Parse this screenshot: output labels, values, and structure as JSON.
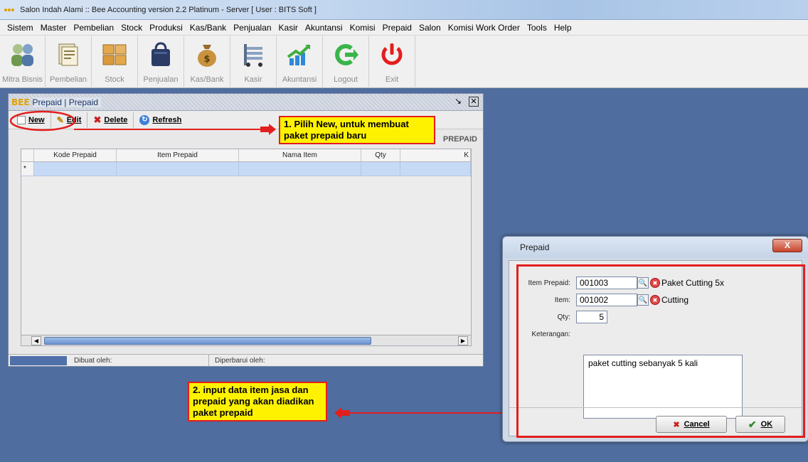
{
  "window": {
    "title": "Salon Indah Alami :: Bee Accounting version 2.2 Platinum - Server  [ User : BITS Soft ]"
  },
  "menu": [
    "Sistem",
    "Master",
    "Pembelian",
    "Stock",
    "Produksi",
    "Kas/Bank",
    "Penjualan",
    "Kasir",
    "Akuntansi",
    "Komisi",
    "Prepaid",
    "Salon",
    "Komisi Work Order",
    "Tools",
    "Help"
  ],
  "toolbar": {
    "items": [
      {
        "label": "Mitra Bisnis",
        "icon": "people-icon",
        "color": "#8aa86a"
      },
      {
        "label": "Pembelian",
        "icon": "documents-icon",
        "color": "#c9b98a"
      },
      {
        "label": "Stock",
        "icon": "boxes-icon",
        "color": "#e3a84e"
      },
      {
        "label": "Penjualan",
        "icon": "shopping-bag-icon",
        "color": "#2b3b66"
      },
      {
        "label": "Kas/Bank",
        "icon": "money-bag-icon",
        "color": "#b98a3a"
      },
      {
        "label": "Kasir",
        "icon": "cash-register-icon",
        "color": "#6c8cb8"
      },
      {
        "label": "Akuntansi",
        "icon": "chart-icon",
        "color": "#3fae3f"
      },
      {
        "label": "Logout",
        "icon": "logout-arrow-icon",
        "color": "#39b54a"
      },
      {
        "label": "Exit",
        "icon": "power-icon",
        "color": "#e31e1e"
      }
    ]
  },
  "inner": {
    "logo": "BEE",
    "title": "Prepaid | Prepaid",
    "tools": {
      "new": "New",
      "edit": "Edit",
      "delete": "Delete",
      "refresh": "Refresh"
    },
    "section_label": "PREPAID",
    "columns": [
      "Kode Prepaid",
      "Item Prepaid",
      "Nama Item",
      "Qty",
      "K"
    ],
    "row_marker": "*",
    "status": {
      "created": "Dibuat oleh:",
      "updated": "Diperbarui oleh:"
    }
  },
  "callouts": {
    "one": "1. Pilih New, untuk membuat paket prepaid baru",
    "two": "2. input data item jasa dan prepaid yang akan diadikan paket prepaid"
  },
  "dialog": {
    "title": "Prepaid",
    "close": "X",
    "fields": {
      "item_prepaid_label": "Item Prepaid:",
      "item_prepaid_code": "001003",
      "item_prepaid_name": "Paket Cutting 5x",
      "item_label": "Item:",
      "item_code": "001002",
      "item_name": "Cutting",
      "qty_label": "Qty:",
      "qty_value": "5",
      "keterangan_label": "Keterangan:",
      "keterangan_value": "paket cutting sebanyak 5 kali"
    },
    "cancel": "Cancel",
    "ok": "OK"
  }
}
